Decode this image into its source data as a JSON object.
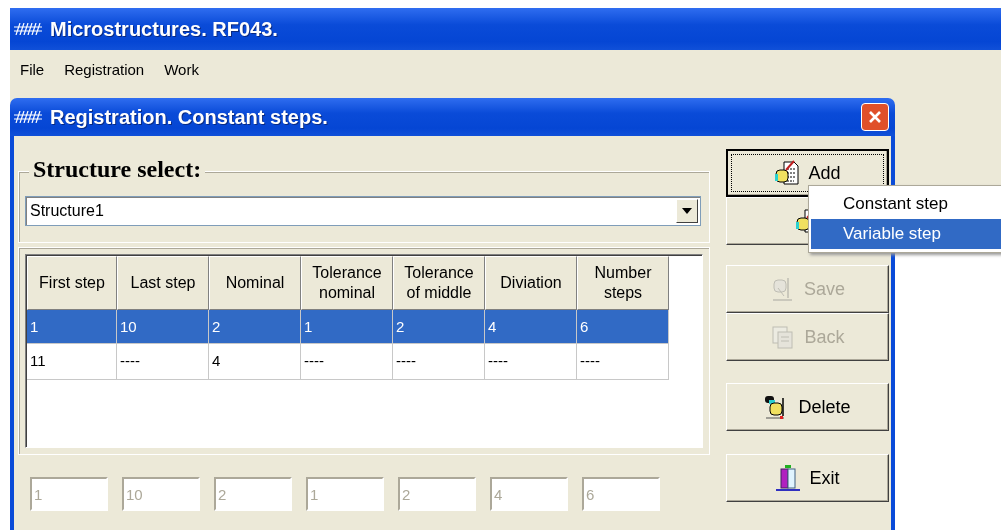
{
  "main_window": {
    "title": "Microstructures. RF043."
  },
  "menu": [
    {
      "label": "File"
    },
    {
      "label": "Registration"
    },
    {
      "label": "Work"
    }
  ],
  "dialog": {
    "title": "Registration. Constant steps.",
    "structure_select": {
      "label": "Structure select:",
      "value": "Structure1"
    },
    "table": {
      "columns": [
        "First step",
        "Last step",
        "Nominal",
        "Tolerance nominal",
        "Tolerance of middle",
        "Diviation",
        "Number steps"
      ],
      "rows": [
        {
          "selected": true,
          "cells": [
            "1",
            "10",
            "2",
            "1",
            "2",
            "4",
            "6"
          ]
        },
        {
          "selected": false,
          "cells": [
            "11",
            "----",
            "4",
            "----",
            "----",
            "----",
            "----"
          ]
        }
      ]
    },
    "edit_fields": [
      {
        "value": "1",
        "disabled": true
      },
      {
        "value": "10",
        "disabled": true
      },
      {
        "value": "2",
        "disabled": true
      },
      {
        "value": "1",
        "disabled": true
      },
      {
        "value": "2",
        "disabled": true
      },
      {
        "value": "4",
        "disabled": true
      },
      {
        "value": "6",
        "disabled": true
      }
    ],
    "buttons": [
      {
        "kind": "add",
        "label": "Add",
        "disabled": false,
        "focused": true
      },
      {
        "kind": "add",
        "disabled": false,
        "focused": false
      },
      {
        "kind": "save",
        "label": "Save",
        "disabled": true,
        "focused": false
      },
      {
        "kind": "back",
        "label": "Back",
        "disabled": true,
        "focused": false
      },
      {
        "kind": "delete",
        "label": "Delete",
        "disabled": false,
        "focused": false
      },
      {
        "kind": "exit",
        "label": "Exit",
        "disabled": false,
        "focused": false
      }
    ]
  },
  "popup_menu": [
    {
      "label": "Constant step",
      "selected": false
    },
    {
      "label": "Variable step",
      "selected": true
    }
  ]
}
